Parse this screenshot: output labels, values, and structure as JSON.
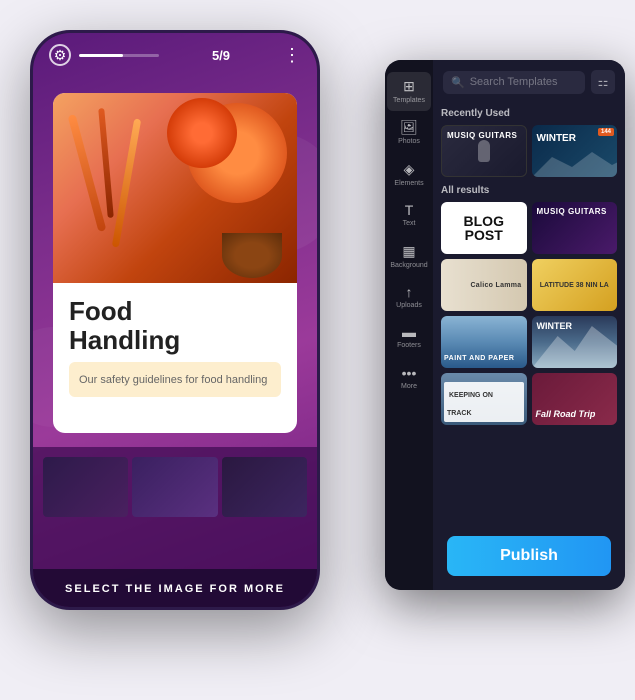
{
  "phone": {
    "progress_current": "5",
    "progress_total": "9",
    "progress_label": "5 / 9",
    "slide_count": "5/9",
    "food_title": "Food\nHandling",
    "food_title_line1": "Food",
    "food_title_line2": "Handling",
    "food_subtitle": "Our safety guidelines\nfor food handling",
    "bottom_label": "SELECT THE IMAGE FOR MORE"
  },
  "sidebar": {
    "items": [
      {
        "label": "Templates",
        "icon": "⊞"
      },
      {
        "label": "Photos",
        "icon": "🖼"
      },
      {
        "label": "Elements",
        "icon": "◈"
      },
      {
        "label": "Text",
        "icon": "T"
      },
      {
        "label": "Background",
        "icon": "▦"
      },
      {
        "label": "Uploads",
        "icon": "↑"
      },
      {
        "label": "Footers",
        "icon": "▬"
      },
      {
        "label": "More",
        "icon": "•••"
      }
    ]
  },
  "search": {
    "placeholder": "Search Templates"
  },
  "sections": {
    "recently_used": "Recently Used",
    "all_results": "All results"
  },
  "templates": {
    "recently_used": [
      {
        "label": "MUSIQ GUITARS",
        "type": "dark-purple"
      },
      {
        "label": "WINTER",
        "type": "winter-blue",
        "badge": "144"
      }
    ],
    "all_results": [
      {
        "label": "BLOG POST",
        "type": "white-text"
      },
      {
        "label": "MUSIQ GUITARS",
        "type": "dark-red"
      },
      {
        "label": "Calico Lamma",
        "type": "beige"
      },
      {
        "label": "LATITUDE 38 NIN LA",
        "type": "yellow"
      },
      {
        "label": "PAINT AND PAPER",
        "type": "blue-sky"
      },
      {
        "label": "WINTER",
        "type": "winter-mountain"
      },
      {
        "label": "KEEPING ON TRACK",
        "type": "city"
      },
      {
        "label": "Fall Road Trip",
        "type": "cursive-white"
      }
    ]
  },
  "publish_button": {
    "label": "Publish"
  }
}
